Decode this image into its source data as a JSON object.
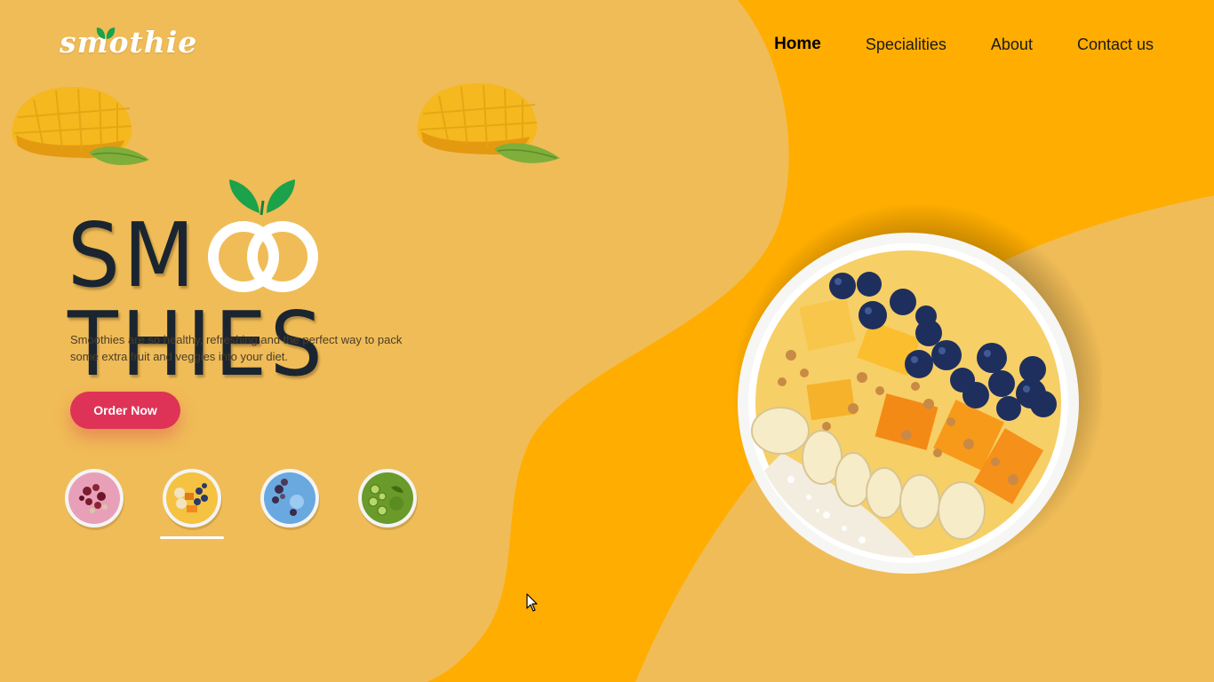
{
  "brand": {
    "logo_text": "smothie"
  },
  "nav": {
    "items": [
      {
        "label": "Home",
        "active": true
      },
      {
        "label": "Specialities",
        "active": false
      },
      {
        "label": "About",
        "active": false
      },
      {
        "label": "Contact us",
        "active": false
      }
    ]
  },
  "hero": {
    "title": "SMOOTHIES",
    "title_prefix": "SM",
    "title_suffix": "THIES",
    "tagline": "Smoothies are so healthy, refreshing and the perfect way to pack some extra fruit and veggies into your diet.",
    "order_button_label": "Order Now"
  },
  "thumbnails": {
    "items": [
      {
        "icon": "berry-smoothie-bowl-thumbnail",
        "selected": false
      },
      {
        "icon": "mango-smoothie-bowl-thumbnail",
        "selected": true
      },
      {
        "icon": "blue-smoothie-bowl-thumbnail",
        "selected": false
      },
      {
        "icon": "green-smoothie-bowl-thumbnail",
        "selected": false
      }
    ]
  },
  "colors": {
    "background": "#f0bc57",
    "wave": "#ffad00",
    "title": "#1b2530",
    "button": "#de3356",
    "leaf": "#1ba24a"
  }
}
